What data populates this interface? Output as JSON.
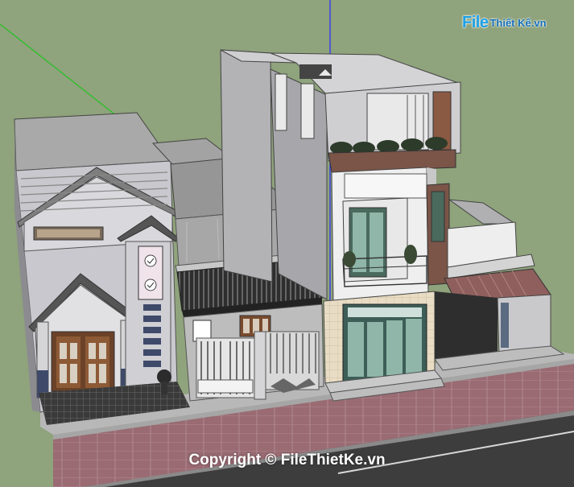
{
  "watermark": {
    "logo_file": "File",
    "logo_rest": "Thiết Kế.vn",
    "copyright": "Copyright © FileThietKe.vn"
  },
  "colors": {
    "background": "#8fa37c",
    "sidewalk": "#9a6b73",
    "road": "#3d3d3d",
    "axis_green": "#22c322",
    "axis_blue": "#2a2aff"
  },
  "scene": {
    "icons": [
      "left-house-icon",
      "middle-house-icon",
      "townhouse-icon",
      "right-annex-icon",
      "sidewalk-icon",
      "road-icon"
    ]
  }
}
